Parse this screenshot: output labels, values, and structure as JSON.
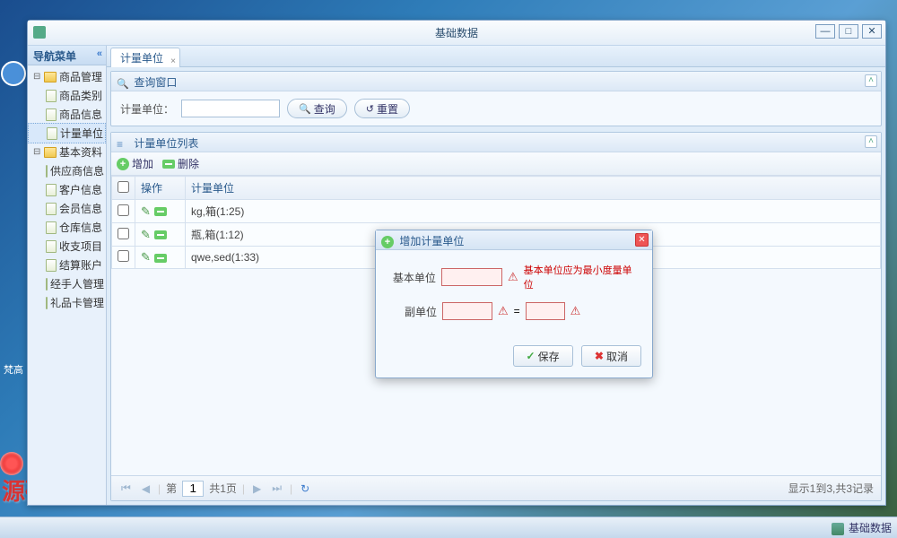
{
  "window": {
    "title": "基础数据"
  },
  "sidebar": {
    "title": "导航菜单",
    "groups": [
      {
        "label": "商品管理",
        "items": [
          "商品类别",
          "商品信息",
          "计量单位"
        ]
      },
      {
        "label": "基本资料",
        "items": [
          "供应商信息",
          "客户信息",
          "会员信息",
          "仓库信息",
          "收支项目",
          "结算账户",
          "经手人管理",
          "礼品卡管理"
        ]
      }
    ]
  },
  "tab": {
    "label": "计量单位"
  },
  "search_panel": {
    "title": "查询窗口",
    "field_label": "计量单位：",
    "query_btn": "查询",
    "reset_btn": "重置"
  },
  "list_panel": {
    "title": "计量单位列表",
    "add_btn": "增加",
    "del_btn": "删除",
    "columns": {
      "ops": "操作",
      "unit": "计量单位"
    },
    "rows": [
      {
        "unit": "kg,箱(1:25)"
      },
      {
        "unit": "瓶,箱(1:12)"
      },
      {
        "unit": "qwe,sed(1:33)"
      }
    ]
  },
  "pager": {
    "page_label_prefix": "第",
    "page": "1",
    "total_pages": "共1页",
    "info": "显示1到3,共3记录"
  },
  "dialog": {
    "title": "增加计量单位",
    "base_label": "基本单位",
    "base_hint": "基本单位应为最小度量单位",
    "sub_label": "副单位",
    "eq": "=",
    "save": "保存",
    "cancel": "取消"
  },
  "dock": {
    "user_label": "梵高"
  },
  "statusbar": {
    "text": "基础数据"
  },
  "watermark": "源码资源网"
}
